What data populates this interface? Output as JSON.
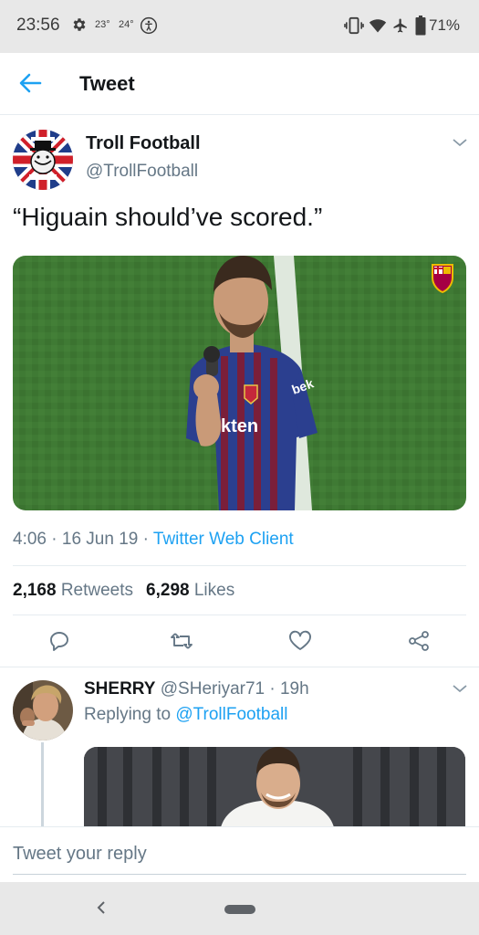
{
  "status_bar": {
    "time": "23:56",
    "temp_1": "23°",
    "temp_2": "24°",
    "battery_percent": "71%",
    "icons": [
      "gear-icon",
      "accessibility-icon",
      "vibrate-icon",
      "wifi-icon",
      "airplane-icon",
      "battery-icon"
    ]
  },
  "header": {
    "title": "Tweet",
    "back_icon": "back-arrow-icon"
  },
  "tweet": {
    "author_name": "Troll Football",
    "author_handle": "@TrollFootball",
    "text": "“Higuain should’ve scored.”",
    "time": "4:06",
    "date": "16 Jun 19",
    "separator": " · ",
    "client": "Twitter Web Client",
    "retweets_count": "2,168",
    "retweets_label": "Retweets",
    "likes_count": "6,298",
    "likes_label": "Likes",
    "actions": [
      "reply-icon",
      "retweet-icon",
      "like-icon",
      "share-icon"
    ]
  },
  "reply": {
    "author_name": "SHERRY",
    "author_handle": "@SHeriyar71",
    "separator": " · ",
    "age": "19h",
    "replying_prefix": "Replying to",
    "replying_to": "@TrollFootball"
  },
  "compose": {
    "placeholder": "Tweet your reply"
  },
  "colors": {
    "accent": "#1da1f2",
    "muted_text": "#657786",
    "primary_text": "#14171a",
    "system_bar": "#e8e8e8"
  }
}
